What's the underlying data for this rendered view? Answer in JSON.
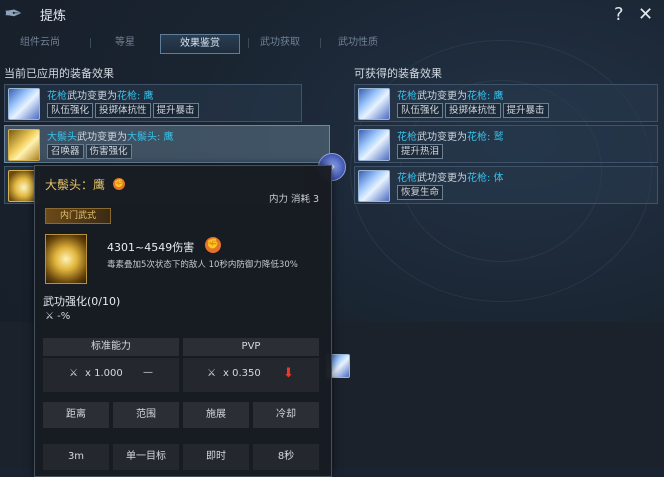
{
  "header": {
    "title": "提炼"
  },
  "tabs": [
    {
      "label": "组件云尚"
    },
    {
      "label": "等星"
    },
    {
      "label": "效果鉴赏"
    },
    {
      "label": "武功获取"
    },
    {
      "label": "武功性质"
    }
  ],
  "left": {
    "title": "当前已应用的装备效果",
    "rows": [
      {
        "p1": "花枪",
        "p2": "武功变更为",
        "p3": "花枪: 鹰",
        "chips": [
          "队伍强化",
          "投掷体抗性",
          "提升暴击"
        ]
      },
      {
        "p1": "大鬃头",
        "p2": "武功变更为",
        "p3": "大鬃头: 鹰",
        "chips": [
          "召唤器",
          "伤害强化"
        ]
      },
      {
        "p1": "",
        "p2": "",
        "p3": "",
        "chips": []
      }
    ]
  },
  "right": {
    "title": "可获得的装备效果",
    "rows": [
      {
        "p1": "花枪",
        "p2": "武功变更为",
        "p3": "花枪: 鹰",
        "chips": [
          "队伍强化",
          "投掷体抗性",
          "提升暴击"
        ]
      },
      {
        "p1": "花枪",
        "p2": "武功变更为",
        "p3": "花枪: 鹫",
        "chips": [
          "提升热泪"
        ]
      },
      {
        "p1": "花枪",
        "p2": "武功变更为",
        "p3": "花枪: 体",
        "chips": [
          "恢复生命"
        ]
      }
    ]
  },
  "orb": "»",
  "tooltip": {
    "name": "大鬃头：鹰",
    "cost": "内力 消耗 3",
    "tag": "内门武式",
    "damage": "4301~4549伤害",
    "desc": "毒素叠加5次状态下的敌人 10秒内防御力降低30%",
    "enhance": "武功强化(0/10)",
    "enhance_val": "-%",
    "std_label": "标准能力",
    "pvp_label": "PVP",
    "std_val": "x 1.000",
    "std_dash": "—",
    "pvp_val": "x 0.350",
    "stats_head": [
      "距离",
      "范围",
      "施展",
      "冷却"
    ],
    "stats_vals": [
      "3m",
      "单一目标",
      "即时",
      "8秒"
    ]
  },
  "colors": {
    "accent": "#35c2ec",
    "gold": "#e8c36a",
    "arrow": "#e83a2a"
  }
}
